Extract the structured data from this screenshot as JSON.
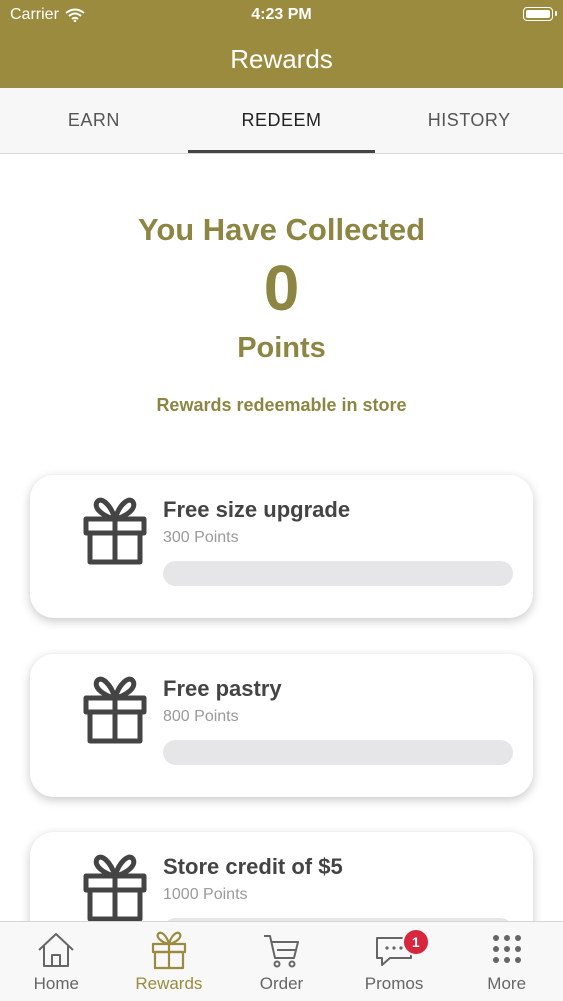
{
  "status_bar": {
    "carrier": "Carrier",
    "time": "4:23 PM"
  },
  "nav": {
    "title": "Rewards"
  },
  "tabs": [
    {
      "label": "EARN",
      "active": false
    },
    {
      "label": "REDEEM",
      "active": true
    },
    {
      "label": "HISTORY",
      "active": false
    }
  ],
  "summary": {
    "title": "You Have Collected",
    "points": "0",
    "points_label": "Points",
    "note": "Rewards redeemable in store"
  },
  "rewards": [
    {
      "title": "Free size upgrade",
      "points": "300 Points",
      "progress": 0
    },
    {
      "title": "Free pastry",
      "points": "800 Points",
      "progress": 0
    },
    {
      "title": "Store credit of $5",
      "points": "1000 Points",
      "progress": 0
    }
  ],
  "tabbar": {
    "items": [
      {
        "label": "Home",
        "icon": "home-icon",
        "active": false
      },
      {
        "label": "Rewards",
        "icon": "gift-icon",
        "active": true
      },
      {
        "label": "Order",
        "icon": "cart-icon",
        "active": false
      },
      {
        "label": "Promos",
        "icon": "chat-icon",
        "active": false,
        "badge": "1"
      },
      {
        "label": "More",
        "icon": "grid-icon",
        "active": false
      }
    ]
  },
  "colors": {
    "brand": "#9a8b3e",
    "accent_text": "#8c8642",
    "badge": "#d7263d"
  }
}
